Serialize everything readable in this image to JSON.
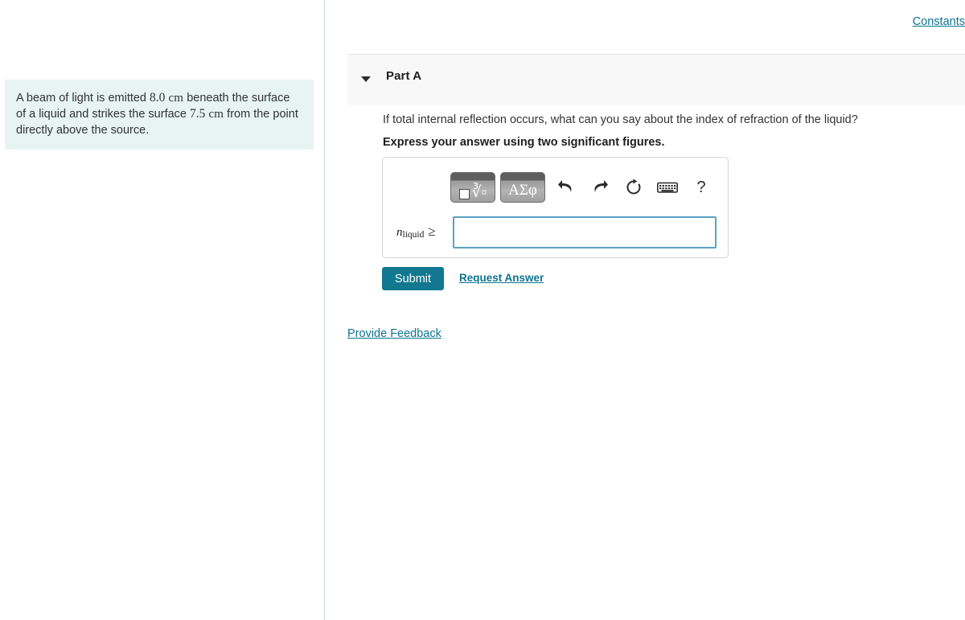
{
  "left": {
    "problem_statement": {
      "seg1": "A beam of light is emitted ",
      "num1": "8.0",
      "unit1": "cm",
      "seg2": " beneath the surface of a liquid and strikes the surface ",
      "num2": "7.5",
      "unit2": "cm",
      "seg3": " from the point directly above the source."
    }
  },
  "right": {
    "constants_link": "Constants",
    "part": {
      "title": "Part A",
      "toggle_icon": "caret-down-icon",
      "question": "If total internal reflection occurs, what can you say about the index of refraction of the liquid?",
      "instruction": "Express your answer using two significant figures."
    },
    "toolbar": {
      "template_button": {
        "name": "math-template-button",
        "root_glyph": "√□"
      },
      "greek_button": {
        "name": "greek-symbols-button",
        "label": "ΑΣφ"
      },
      "undo_icon": "undo-icon",
      "redo_icon": "redo-icon",
      "reset_icon": "reset-icon",
      "keyboard_icon": "keyboard-icon",
      "help_icon": "help-icon",
      "help_label": "?"
    },
    "answer": {
      "label_symbol": "n",
      "label_subscript": "liquid",
      "label_relation": "≥",
      "value": "",
      "placeholder": ""
    },
    "actions": {
      "submit_label": "Submit",
      "request_answer_label": "Request Answer"
    },
    "feedback_link": "Provide Feedback"
  },
  "colors": {
    "accent_teal": "#11788f",
    "link_teal": "#0d7490",
    "problem_bg": "#e7f4f2",
    "input_border": "#59a2c4",
    "header_bg": "#f8f8f8"
  }
}
